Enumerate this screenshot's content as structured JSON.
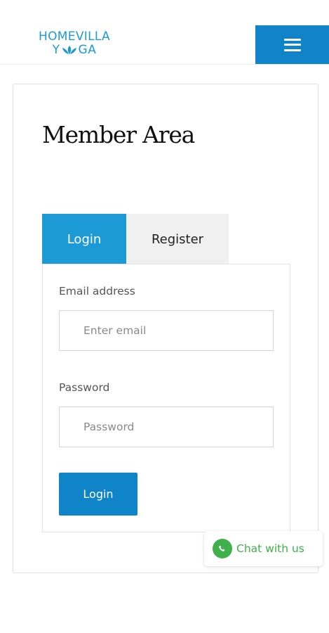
{
  "header": {
    "logo_line1": "HOMEVILLA",
    "logo_line2_left": "Y",
    "logo_line2_right": "GA",
    "menu_icon": "hamburger-icon",
    "accent_color": "#0f84c9"
  },
  "main": {
    "title": "Member Area",
    "tabs": [
      {
        "label": "Login",
        "active": true
      },
      {
        "label": "Register",
        "active": false
      }
    ],
    "form": {
      "email_label": "Email address",
      "email_placeholder": "Enter email",
      "email_value": "",
      "password_label": "Password",
      "password_placeholder": "Password",
      "password_value": "",
      "submit_label": "Login"
    }
  },
  "chat": {
    "label": "Chat with us",
    "icon": "whatsapp-icon",
    "color": "#3fb04a"
  }
}
